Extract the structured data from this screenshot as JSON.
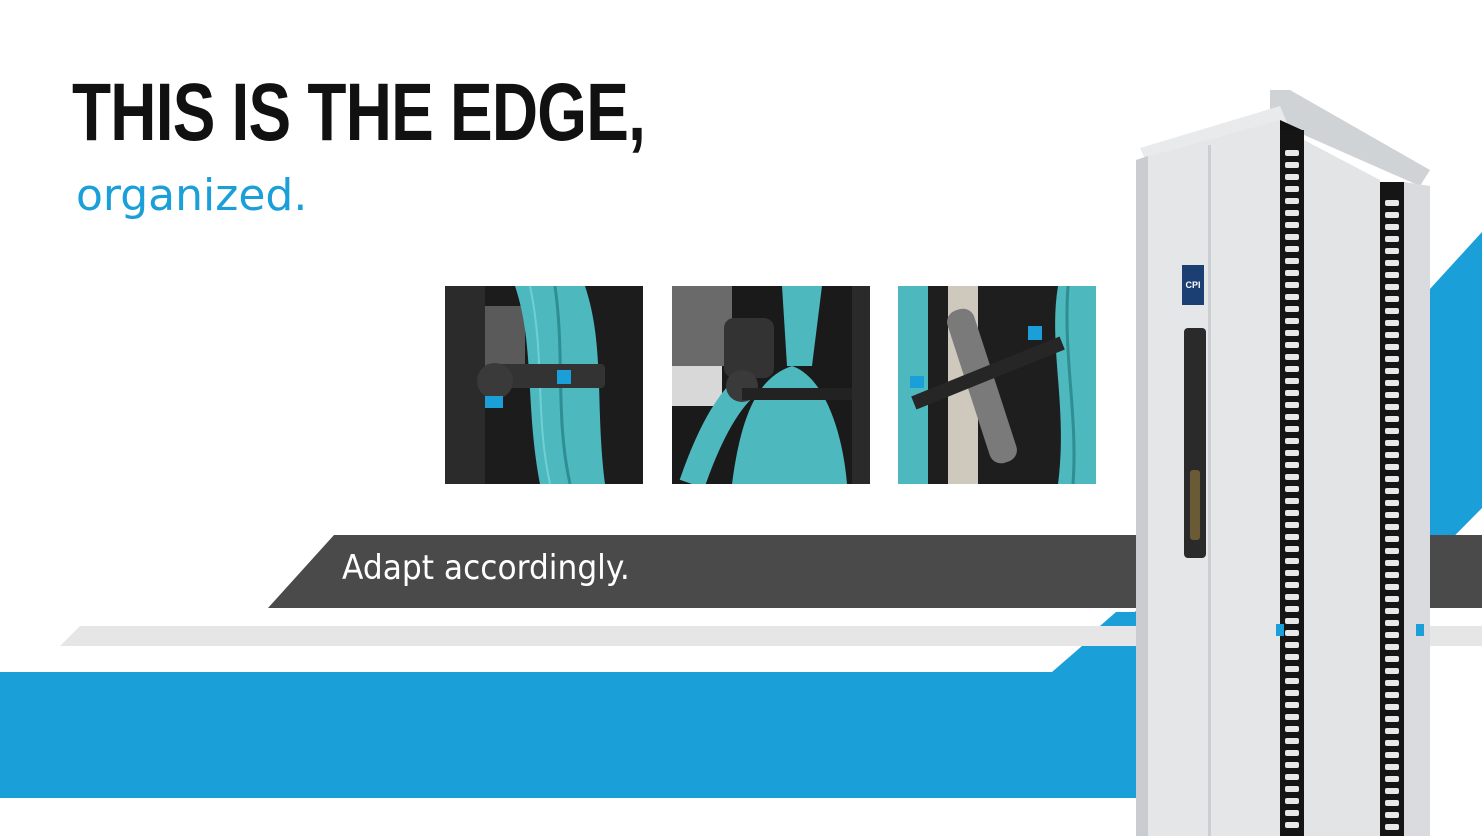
{
  "hero": {
    "headline": "THIS IS THE EDGE,",
    "subheadline": "organized."
  },
  "banner": {
    "text": "Adapt accordingly."
  },
  "product": {
    "logo_text": "CPI"
  },
  "thumbnails": [
    {
      "subject": "cable-management-bracket-front"
    },
    {
      "subject": "cable-management-bracket-side"
    },
    {
      "subject": "cable-management-bracket-angle"
    }
  ],
  "colors": {
    "accent_blue": "#1a9fd9",
    "banner_gray": "#4a4a4a",
    "stripe_light_gray": "#e6e6e6",
    "headline_black": "#111111",
    "cable_teal": "#4db8bd"
  }
}
